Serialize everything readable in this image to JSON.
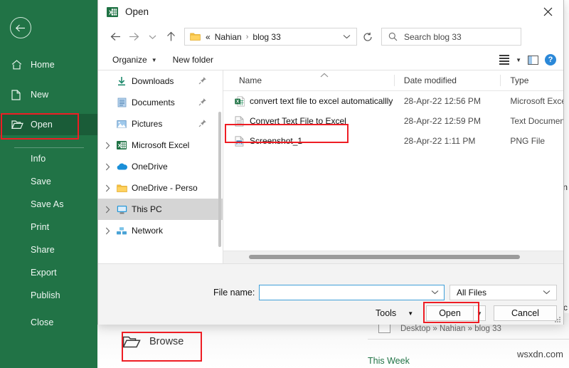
{
  "backstage": {
    "back_icon": "back-arrow-icon",
    "items": [
      {
        "label": "Home",
        "icon": "home-icon",
        "selected": false,
        "indent": false
      },
      {
        "label": "New",
        "icon": "page-icon",
        "selected": false,
        "indent": false
      },
      {
        "label": "Open",
        "icon": "folder-icon",
        "selected": true,
        "indent": false
      },
      {
        "label": "Info",
        "icon": "",
        "selected": false,
        "indent": true
      },
      {
        "label": "Save",
        "icon": "",
        "selected": false,
        "indent": true
      },
      {
        "label": "Save As",
        "icon": "",
        "selected": false,
        "indent": true
      },
      {
        "label": "Print",
        "icon": "",
        "selected": false,
        "indent": true
      },
      {
        "label": "Share",
        "icon": "",
        "selected": false,
        "indent": true
      },
      {
        "label": "Export",
        "icon": "",
        "selected": false,
        "indent": true
      },
      {
        "label": "Publish",
        "icon": "",
        "selected": false,
        "indent": true
      },
      {
        "label": "Close",
        "icon": "",
        "selected": false,
        "indent": true
      }
    ],
    "accent_color": "#217346",
    "selected_color": "#1a5c38",
    "highlight_color": "#ee1d24"
  },
  "background": {
    "browse_label": "Browse",
    "browse_icon": "open-folder-icon",
    "recent_path": "Desktop » Nahian » blog 33",
    "this_week_label": "This Week",
    "watermark": "wsxdn.com",
    "edge_text_top": "n",
    "edge_text_bottom": "c"
  },
  "dialog": {
    "title": "Open",
    "title_icon": "excel-icon",
    "close_icon": "close-icon",
    "nav": {
      "back_icon": "arrow-left-icon",
      "forward_icon": "arrow-right-icon",
      "recent_icon": "chevron-down-icon",
      "up_icon": "arrow-up-icon",
      "address_folder_icon": "folder-icon",
      "breadcrumbs": [
        "«",
        "Nahian",
        "blog 33"
      ],
      "breadcrumb_separator": "›",
      "address_chevron": "chevron-down-icon",
      "refresh_icon": "refresh-icon",
      "search_icon": "search-icon",
      "search_placeholder": "Search blog 33"
    },
    "commands": {
      "organize": "Organize",
      "organize_caret": "▼",
      "new_folder": "New folder",
      "view_icon": "view-list-icon",
      "view_caret": "▼",
      "pane_icon": "preview-pane-icon",
      "help_icon": "help-icon",
      "help_glyph": "?"
    },
    "tree": {
      "items": [
        {
          "label": "Downloads",
          "icon": "download-icon",
          "chevron": false,
          "pinned": true,
          "selected": false
        },
        {
          "label": "Documents",
          "icon": "documents-icon",
          "chevron": false,
          "pinned": true,
          "selected": false
        },
        {
          "label": "Pictures",
          "icon": "pictures-icon",
          "chevron": false,
          "pinned": true,
          "selected": false
        },
        {
          "label": "Microsoft Excel",
          "icon": "excel-icon",
          "chevron": true,
          "pinned": false,
          "selected": false
        },
        {
          "label": "OneDrive",
          "icon": "onedrive-icon",
          "chevron": true,
          "pinned": false,
          "selected": false
        },
        {
          "label": "OneDrive - Perso",
          "icon": "folder-icon",
          "chevron": true,
          "pinned": false,
          "selected": false
        },
        {
          "label": "This PC",
          "icon": "thispc-icon",
          "chevron": true,
          "pinned": false,
          "selected": true
        },
        {
          "label": "Network",
          "icon": "network-icon",
          "chevron": true,
          "pinned": false,
          "selected": false
        }
      ],
      "pin_glyph": "📌"
    },
    "file_list": {
      "columns": [
        "Name",
        "Date modified",
        "Type"
      ],
      "sort_indicator": "^",
      "rows": [
        {
          "name": "convert text file to excel automaticallly",
          "date": "28-Apr-22 12:56 PM",
          "type": "Microsoft Excel ",
          "icon": "excel-file-icon",
          "highlighted": false
        },
        {
          "name": "Convert Text File to Excel",
          "date": "28-Apr-22 12:59 PM",
          "type": "Text Document",
          "icon": "text-file-icon",
          "highlighted": true
        },
        {
          "name": "Screenshot_1",
          "date": "28-Apr-22 1:11 PM",
          "type": "PNG File",
          "icon": "image-file-icon",
          "highlighted": false
        }
      ]
    },
    "footer": {
      "filename_label": "File name:",
      "filename_value": "",
      "filename_chevron": "chevron-down-icon",
      "filetype_value": "All Files",
      "filetype_chevron": "chevron-down-icon",
      "tools_label": "Tools",
      "tools_caret": "▼",
      "open_label": "Open",
      "open_split_caret": "▼",
      "cancel_label": "Cancel"
    }
  }
}
